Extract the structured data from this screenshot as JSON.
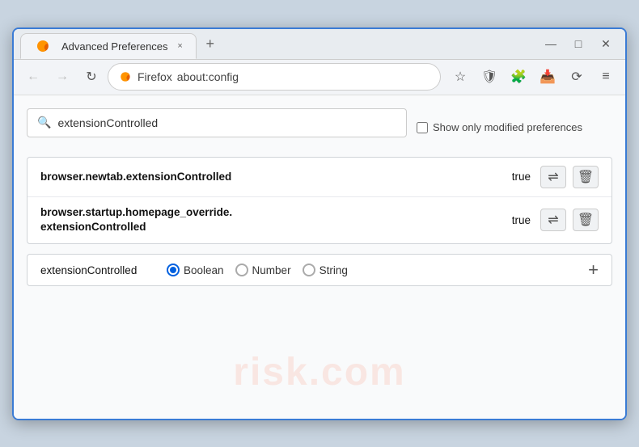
{
  "window": {
    "title": "Advanced Preferences",
    "tab_close_label": "×",
    "new_tab_label": "+",
    "minimize_label": "—",
    "maximize_label": "□",
    "close_label": "✕"
  },
  "navbar": {
    "back_icon": "←",
    "forward_icon": "→",
    "reload_icon": "↻",
    "browser_name": "Firefox",
    "url": "about:config",
    "bookmark_icon": "☆",
    "shield_icon": "🛡",
    "extension_icon": "🧩",
    "downloads_icon": "📥",
    "sync_icon": "⟳",
    "menu_icon": "≡"
  },
  "search": {
    "placeholder": "",
    "value": "extensionControlled",
    "show_modified_label": "Show only modified preferences"
  },
  "preferences": [
    {
      "name": "browser.newtab.extensionControlled",
      "value": "true",
      "multiline": false
    },
    {
      "name_line1": "browser.startup.homepage_override.",
      "name_line2": "extensionControlled",
      "value": "true",
      "multiline": true
    }
  ],
  "add_row": {
    "name": "extensionControlled",
    "types": [
      {
        "label": "Boolean",
        "selected": true
      },
      {
        "label": "Number",
        "selected": false
      },
      {
        "label": "String",
        "selected": false
      }
    ],
    "add_button_label": "+"
  },
  "icons": {
    "search": "🔍",
    "reset": "⇌",
    "delete": "🗑"
  },
  "watermark": "risk.com"
}
